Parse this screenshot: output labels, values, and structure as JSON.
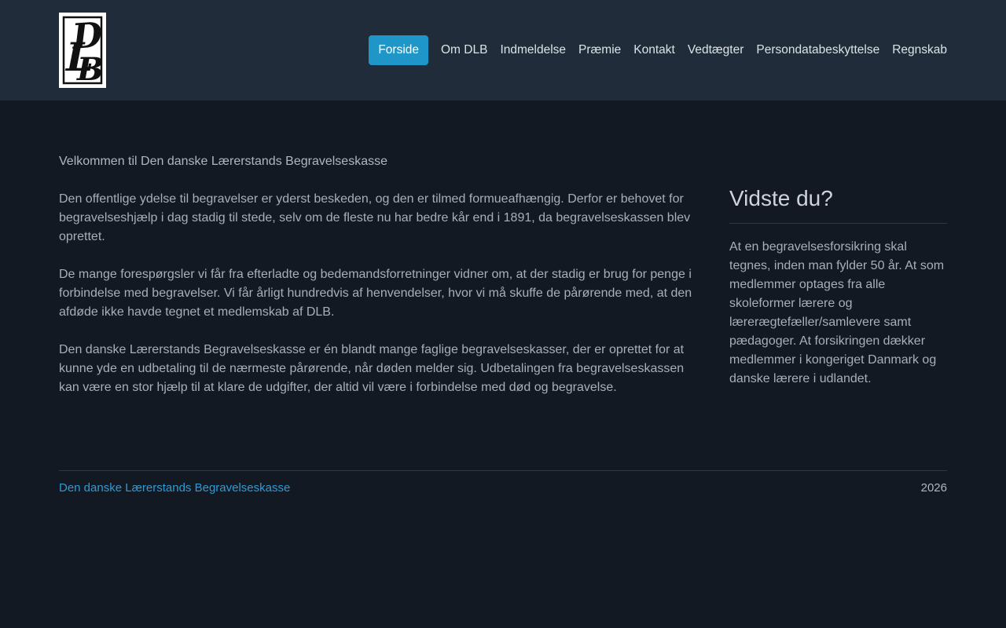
{
  "header": {
    "logo": {
      "d": "D",
      "l": "L",
      "b": "B"
    },
    "nav": [
      {
        "label": "Forside",
        "active": true
      },
      {
        "label": "Om DLB",
        "active": false
      },
      {
        "label": "Indmeldelse",
        "active": false
      },
      {
        "label": "Præmie",
        "active": false
      },
      {
        "label": "Kontakt",
        "active": false
      },
      {
        "label": "Vedtægter",
        "active": false
      },
      {
        "label": "Persondatabeskyttelse",
        "active": false
      },
      {
        "label": "Regnskab",
        "active": false
      }
    ]
  },
  "main": {
    "title": "Velkommen til Den danske Lærerstands Begravelseskasse",
    "paragraphs": [
      "Den offentlige ydelse til begravelser er yderst beskeden, og den er tilmed formueafhængig. Derfor er behovet for begravelseshjælp i dag stadig til stede, selv om de fleste nu har bedre kår end i 1891, da begravelseskassen blev oprettet.",
      "De mange forespørgsler vi får fra efterladte og bedemandsforretninger vidner om, at der stadig er brug for penge i forbindelse med begravelser. Vi får årligt hundredvis af henvendelser, hvor vi må skuffe de pårørende med, at den afdøde ikke havde tegnet et medlemskab af DLB.",
      "Den danske Lærerstands Begravelseskasse er én blandt mange faglige begravelseskasser, der er oprettet for at kunne yde en udbetaling til de nærmeste pårørende, når døden melder sig. Udbetalingen fra begravelseskassen kan være en stor hjælp til at klare de udgifter, der altid vil være i forbindelse med død og begravelse."
    ],
    "sidebar": {
      "title": "Vidste du?",
      "text": "At en begravelsesforsikring skal tegnes, inden man fylder 50 år. At som medlemmer optages fra alle skoleformer lærere og lærerægtefæller/samlevere samt pædagoger. At forsikringen dækker medlemmer i kongeriget Danmark og danske lærere i udlandet."
    }
  },
  "footer": {
    "site_name": "Den danske Lærerstands Begravelseskasse",
    "year": "2026"
  },
  "colors": {
    "header_bg": "#202c39",
    "page_bg": "#121923",
    "accent": "#1e96c8",
    "link": "#2d9cd6",
    "body_text": "#a6b0b9",
    "nav_text": "#dce3e8"
  }
}
